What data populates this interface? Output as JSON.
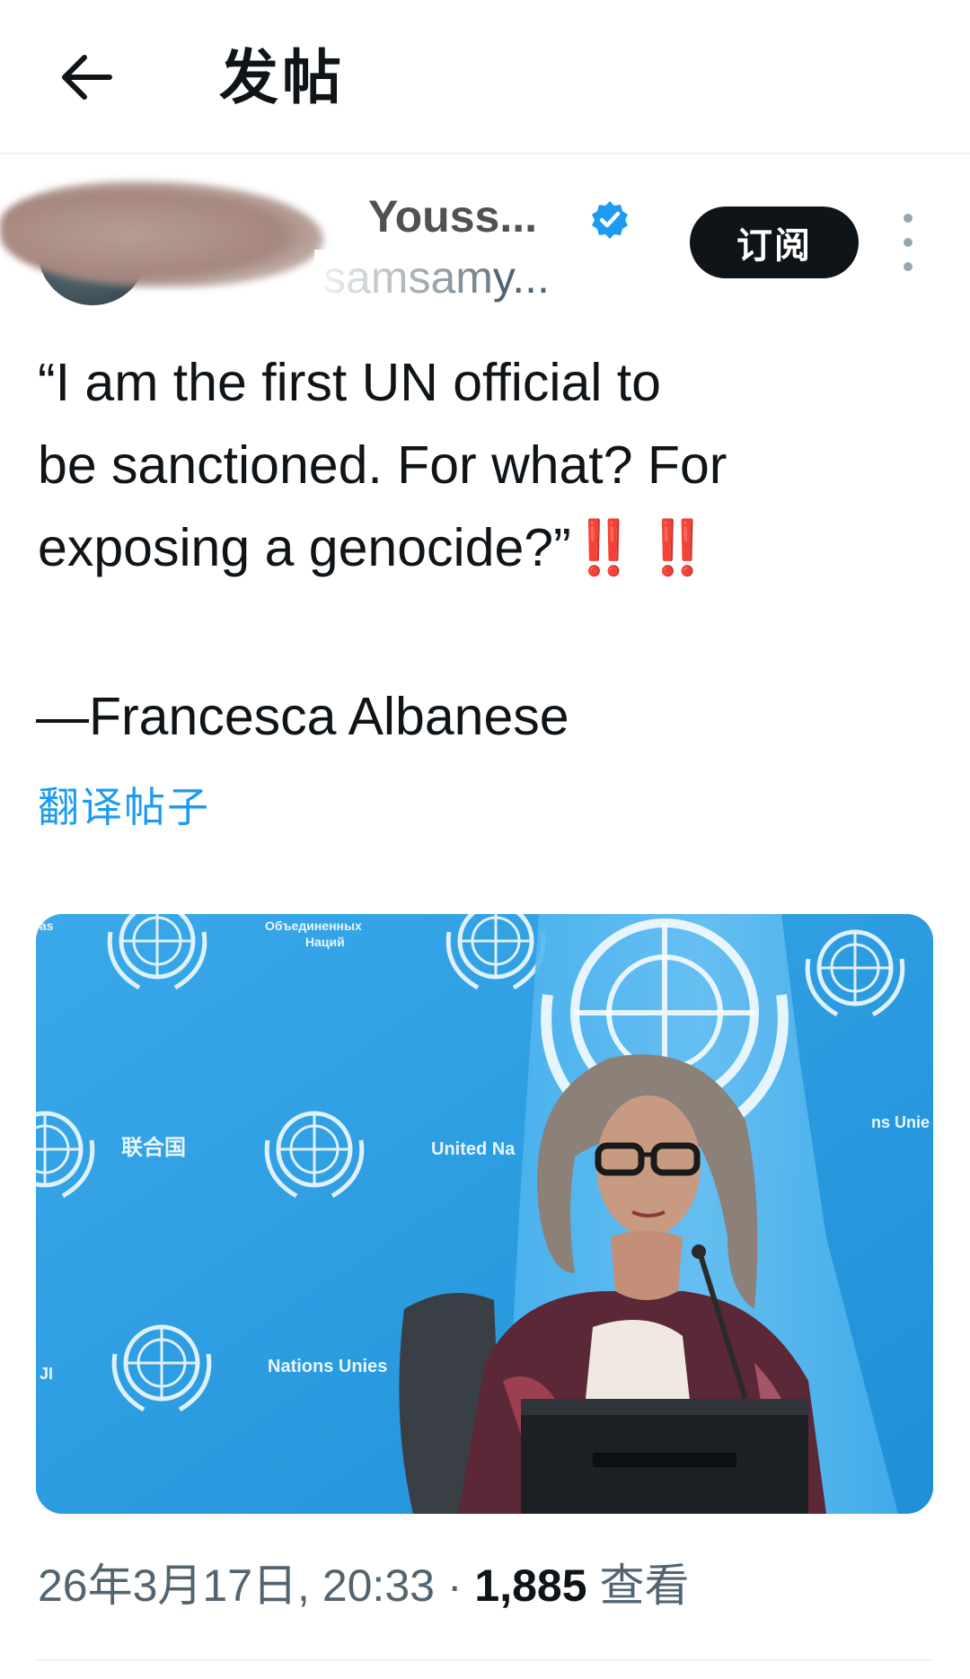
{
  "header": {
    "title": "发帖",
    "back_icon": "arrow-left-icon"
  },
  "author": {
    "display_name": "Youss...",
    "handle": "samsamy...",
    "verified_icon": "verified-badge-icon",
    "subscribe_label": "订阅",
    "more_icon": "more-vertical-icon"
  },
  "post": {
    "lines": [
      "“I am the first UN official to",
      "be sanctioned. For what? For",
      "exposing a genocide?”"
    ],
    "emphasis": "‼️ ‼️",
    "attribution": "—Francesca Albanese",
    "translate_label": "翻译帖子"
  },
  "media": {
    "backdrop_labels": [
      "Объединенных Наций",
      "联合国",
      "United Na",
      "ns Unie",
      "Nations Unies",
      "ЈI",
      "as"
    ]
  },
  "meta": {
    "timestamp": "26年3月17日, 20:33",
    "separator": "·",
    "views_count": "1,885",
    "views_label": "查看"
  },
  "colors": {
    "accent": "#1d9bf0",
    "text": "#0f1419",
    "muted": "#536471",
    "alert_red": "#d4161d"
  }
}
